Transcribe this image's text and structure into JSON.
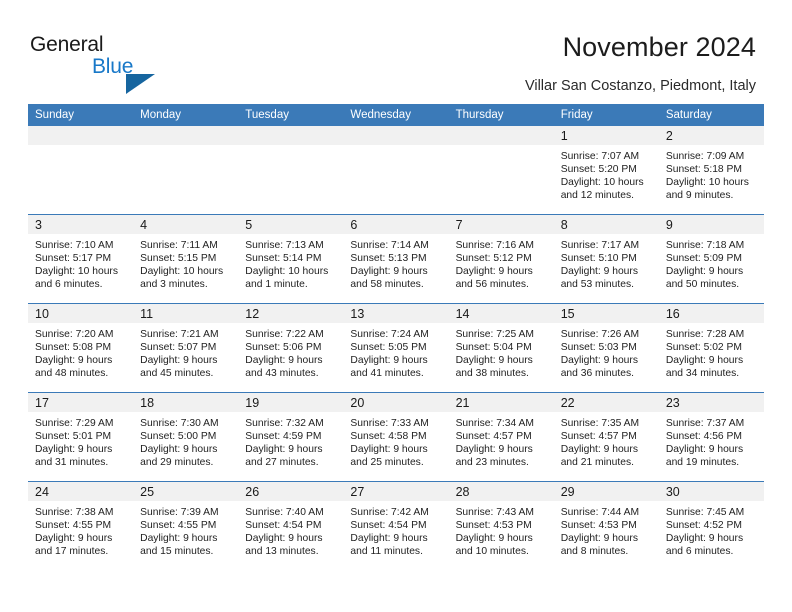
{
  "brand": {
    "name_primary": "General",
    "name_secondary": "Blue",
    "triangle_color": "#16659f",
    "secondary_color": "#1878c8"
  },
  "header": {
    "title": "November 2024",
    "subtitle": "Villar San Costanzo, Piedmont, Italy",
    "accent_color": "#3b7ab8",
    "daynum_band_color": "#f1f1f1"
  },
  "weekdays": [
    "Sunday",
    "Monday",
    "Tuesday",
    "Wednesday",
    "Thursday",
    "Friday",
    "Saturday"
  ],
  "labels": {
    "sunrise_prefix": "Sunrise:",
    "sunset_prefix": "Sunset:",
    "daylight_prefix": "Daylight:"
  },
  "weeks": [
    [
      {
        "day": "",
        "empty": true
      },
      {
        "day": "",
        "empty": true
      },
      {
        "day": "",
        "empty": true
      },
      {
        "day": "",
        "empty": true
      },
      {
        "day": "",
        "empty": true
      },
      {
        "day": "1",
        "sunrise": "Sunrise: 7:07 AM",
        "sunset": "Sunset: 5:20 PM",
        "daylight": "Daylight: 10 hours and 12 minutes."
      },
      {
        "day": "2",
        "sunrise": "Sunrise: 7:09 AM",
        "sunset": "Sunset: 5:18 PM",
        "daylight": "Daylight: 10 hours and 9 minutes."
      }
    ],
    [
      {
        "day": "3",
        "sunrise": "Sunrise: 7:10 AM",
        "sunset": "Sunset: 5:17 PM",
        "daylight": "Daylight: 10 hours and 6 minutes."
      },
      {
        "day": "4",
        "sunrise": "Sunrise: 7:11 AM",
        "sunset": "Sunset: 5:15 PM",
        "daylight": "Daylight: 10 hours and 3 minutes."
      },
      {
        "day": "5",
        "sunrise": "Sunrise: 7:13 AM",
        "sunset": "Sunset: 5:14 PM",
        "daylight": "Daylight: 10 hours and 1 minute."
      },
      {
        "day": "6",
        "sunrise": "Sunrise: 7:14 AM",
        "sunset": "Sunset: 5:13 PM",
        "daylight": "Daylight: 9 hours and 58 minutes."
      },
      {
        "day": "7",
        "sunrise": "Sunrise: 7:16 AM",
        "sunset": "Sunset: 5:12 PM",
        "daylight": "Daylight: 9 hours and 56 minutes."
      },
      {
        "day": "8",
        "sunrise": "Sunrise: 7:17 AM",
        "sunset": "Sunset: 5:10 PM",
        "daylight": "Daylight: 9 hours and 53 minutes."
      },
      {
        "day": "9",
        "sunrise": "Sunrise: 7:18 AM",
        "sunset": "Sunset: 5:09 PM",
        "daylight": "Daylight: 9 hours and 50 minutes."
      }
    ],
    [
      {
        "day": "10",
        "sunrise": "Sunrise: 7:20 AM",
        "sunset": "Sunset: 5:08 PM",
        "daylight": "Daylight: 9 hours and 48 minutes."
      },
      {
        "day": "11",
        "sunrise": "Sunrise: 7:21 AM",
        "sunset": "Sunset: 5:07 PM",
        "daylight": "Daylight: 9 hours and 45 minutes."
      },
      {
        "day": "12",
        "sunrise": "Sunrise: 7:22 AM",
        "sunset": "Sunset: 5:06 PM",
        "daylight": "Daylight: 9 hours and 43 minutes."
      },
      {
        "day": "13",
        "sunrise": "Sunrise: 7:24 AM",
        "sunset": "Sunset: 5:05 PM",
        "daylight": "Daylight: 9 hours and 41 minutes."
      },
      {
        "day": "14",
        "sunrise": "Sunrise: 7:25 AM",
        "sunset": "Sunset: 5:04 PM",
        "daylight": "Daylight: 9 hours and 38 minutes."
      },
      {
        "day": "15",
        "sunrise": "Sunrise: 7:26 AM",
        "sunset": "Sunset: 5:03 PM",
        "daylight": "Daylight: 9 hours and 36 minutes."
      },
      {
        "day": "16",
        "sunrise": "Sunrise: 7:28 AM",
        "sunset": "Sunset: 5:02 PM",
        "daylight": "Daylight: 9 hours and 34 minutes."
      }
    ],
    [
      {
        "day": "17",
        "sunrise": "Sunrise: 7:29 AM",
        "sunset": "Sunset: 5:01 PM",
        "daylight": "Daylight: 9 hours and 31 minutes."
      },
      {
        "day": "18",
        "sunrise": "Sunrise: 7:30 AM",
        "sunset": "Sunset: 5:00 PM",
        "daylight": "Daylight: 9 hours and 29 minutes."
      },
      {
        "day": "19",
        "sunrise": "Sunrise: 7:32 AM",
        "sunset": "Sunset: 4:59 PM",
        "daylight": "Daylight: 9 hours and 27 minutes."
      },
      {
        "day": "20",
        "sunrise": "Sunrise: 7:33 AM",
        "sunset": "Sunset: 4:58 PM",
        "daylight": "Daylight: 9 hours and 25 minutes."
      },
      {
        "day": "21",
        "sunrise": "Sunrise: 7:34 AM",
        "sunset": "Sunset: 4:57 PM",
        "daylight": "Daylight: 9 hours and 23 minutes."
      },
      {
        "day": "22",
        "sunrise": "Sunrise: 7:35 AM",
        "sunset": "Sunset: 4:57 PM",
        "daylight": "Daylight: 9 hours and 21 minutes."
      },
      {
        "day": "23",
        "sunrise": "Sunrise: 7:37 AM",
        "sunset": "Sunset: 4:56 PM",
        "daylight": "Daylight: 9 hours and 19 minutes."
      }
    ],
    [
      {
        "day": "24",
        "sunrise": "Sunrise: 7:38 AM",
        "sunset": "Sunset: 4:55 PM",
        "daylight": "Daylight: 9 hours and 17 minutes."
      },
      {
        "day": "25",
        "sunrise": "Sunrise: 7:39 AM",
        "sunset": "Sunset: 4:55 PM",
        "daylight": "Daylight: 9 hours and 15 minutes."
      },
      {
        "day": "26",
        "sunrise": "Sunrise: 7:40 AM",
        "sunset": "Sunset: 4:54 PM",
        "daylight": "Daylight: 9 hours and 13 minutes."
      },
      {
        "day": "27",
        "sunrise": "Sunrise: 7:42 AM",
        "sunset": "Sunset: 4:54 PM",
        "daylight": "Daylight: 9 hours and 11 minutes."
      },
      {
        "day": "28",
        "sunrise": "Sunrise: 7:43 AM",
        "sunset": "Sunset: 4:53 PM",
        "daylight": "Daylight: 9 hours and 10 minutes."
      },
      {
        "day": "29",
        "sunrise": "Sunrise: 7:44 AM",
        "sunset": "Sunset: 4:53 PM",
        "daylight": "Daylight: 9 hours and 8 minutes."
      },
      {
        "day": "30",
        "sunrise": "Sunrise: 7:45 AM",
        "sunset": "Sunset: 4:52 PM",
        "daylight": "Daylight: 9 hours and 6 minutes."
      }
    ]
  ]
}
